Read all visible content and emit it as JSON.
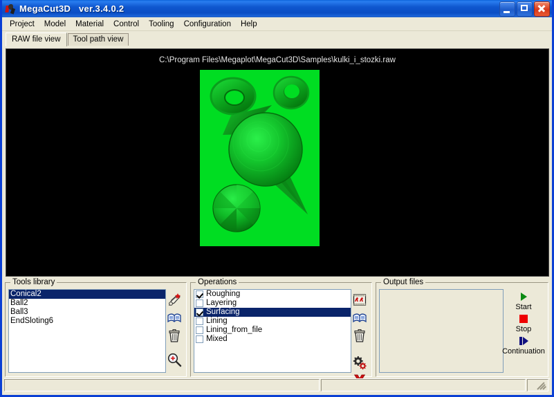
{
  "window": {
    "title": "MegaCut3D   ver.3.4.0.2",
    "app_icon": "cutting-tool-icon",
    "frame_color": "#0a3fd4",
    "titlebar_color": "#0f57cf",
    "face_color": "#ece9d8"
  },
  "titlebuttons": {
    "minimize": "minimize-icon",
    "maximize": "maximize-icon",
    "close": "close-icon"
  },
  "menubar": {
    "items": [
      {
        "label": "Project"
      },
      {
        "label": "Model"
      },
      {
        "label": "Material"
      },
      {
        "label": "Control"
      },
      {
        "label": "Tooling"
      },
      {
        "label": "Configuration"
      },
      {
        "label": "Help"
      }
    ]
  },
  "tabs": [
    {
      "label": "RAW file view",
      "active": true
    },
    {
      "label": "Tool path view",
      "active": false
    }
  ],
  "viewer": {
    "file_path": "C:\\Program Files\\Megaplot\\MegaCut3D\\Samples\\kulki_i_stozki.raw",
    "background_color": "#000000",
    "render_background_color": "#00dd22",
    "render_accent_color": "#008f14",
    "objects": [
      {
        "name": "torus-large",
        "shape": "torus"
      },
      {
        "name": "torus-small",
        "shape": "torus"
      },
      {
        "name": "sphere-large",
        "shape": "sphere"
      },
      {
        "name": "cone-lower-right",
        "shape": "cone"
      },
      {
        "name": "cone-upper-left",
        "shape": "cone"
      },
      {
        "name": "sphere-small",
        "shape": "sphere"
      }
    ]
  },
  "tools_library": {
    "title": "Tools library",
    "items": [
      {
        "label": "Conical2",
        "selected": true
      },
      {
        "label": "Ball2",
        "selected": false
      },
      {
        "label": "Ball3",
        "selected": false
      },
      {
        "label": "EndSloting6",
        "selected": false
      }
    ],
    "icons": [
      {
        "name": "new-tool-icon"
      },
      {
        "name": "tool-library-book-icon"
      },
      {
        "name": "delete-tool-trash-icon"
      },
      {
        "name": "zoom-tool-icon"
      }
    ]
  },
  "operations": {
    "title": "Operations",
    "items": [
      {
        "label": "Roughing",
        "checked": true,
        "selected": false
      },
      {
        "label": "Layering",
        "checked": false,
        "selected": false
      },
      {
        "label": "Surfacing",
        "checked": true,
        "selected": true
      },
      {
        "label": "Lining",
        "checked": false,
        "selected": false
      },
      {
        "label": "Lining_from_file",
        "checked": false,
        "selected": false
      },
      {
        "label": "Mixed",
        "checked": false,
        "selected": false
      }
    ],
    "icons": [
      {
        "name": "edit-operation-filmstrip-icon"
      },
      {
        "name": "operation-library-book-icon"
      },
      {
        "name": "delete-operation-trash-icon"
      },
      {
        "name": "operation-settings-gears-icon"
      },
      {
        "name": "cancel-operation-x-icon"
      }
    ]
  },
  "output_files": {
    "title": "Output files",
    "items": []
  },
  "run_controls": [
    {
      "label": "Start",
      "glyph": "play-triangle-icon",
      "color": "#0a8a12"
    },
    {
      "label": "Stop",
      "glyph": "stop-square-icon",
      "color": "#ee0000"
    },
    {
      "label": "Continuation",
      "glyph": "continue-icon",
      "color": "#101080"
    }
  ],
  "statusbar": {
    "panel1": "",
    "panel2": "",
    "panel3": "",
    "grip": "resize-grip-icon"
  }
}
